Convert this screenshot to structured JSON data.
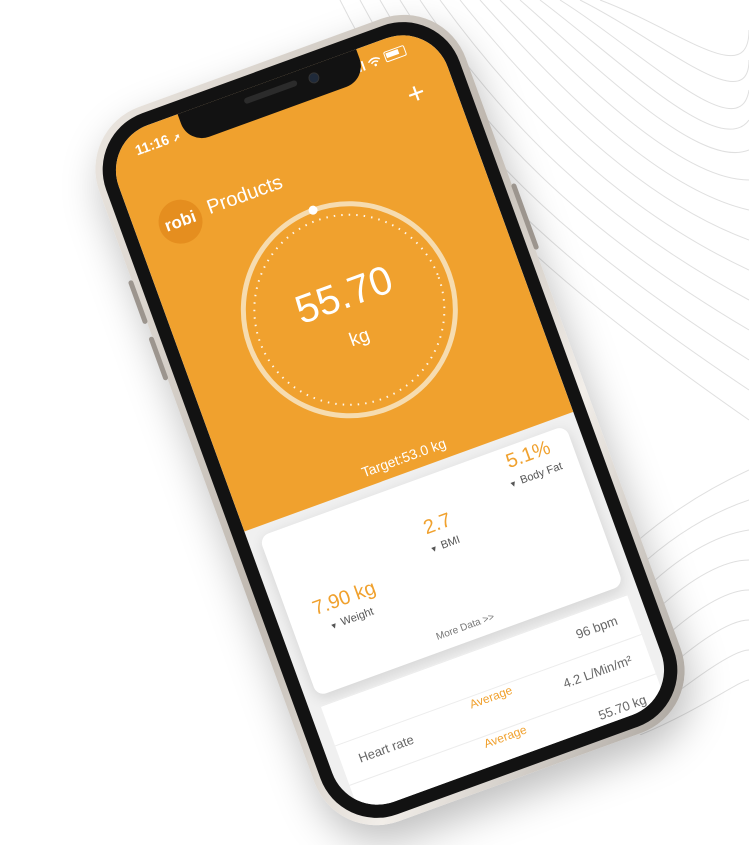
{
  "status": {
    "time": "11:16",
    "location_glyph": "➚"
  },
  "header": {
    "logo_text": "robi",
    "title": "Products",
    "add_label": "+"
  },
  "gauge": {
    "value": "55.70",
    "unit": "kg",
    "progress": 1.0
  },
  "target": "Target:53.0 kg",
  "metrics": [
    {
      "value": "7.90 kg",
      "label": "Weight"
    },
    {
      "value": "2.7",
      "label": "BMI"
    },
    {
      "value": "5.1%",
      "label": "Body Fat"
    }
  ],
  "more_data": "More Data >>",
  "details": [
    {
      "label": "",
      "status": "",
      "value": "96 bpm"
    },
    {
      "label": "Heart rate",
      "status": "Average",
      "value": "4.2 L/Min/m²"
    },
    {
      "label": "",
      "status": "Average",
      "value": "55.70 kg"
    }
  ],
  "colors": {
    "accent": "#f0a12e",
    "text": "#ffffff"
  }
}
